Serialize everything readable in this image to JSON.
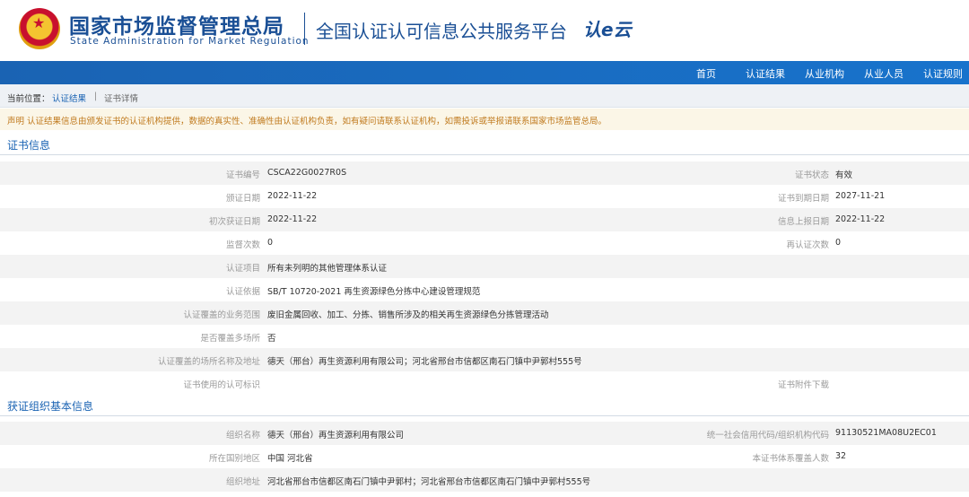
{
  "header": {
    "title_cn": "国家市场监督管理总局",
    "title_en": "State Administration  for  Market Regulation",
    "platform": "全国认证认可信息公共服务平台",
    "logo_mark": "认e云"
  },
  "nav": [
    "首页",
    "认证结果",
    "从业机构",
    "从业人员",
    "认证规则"
  ],
  "breadcrumb": {
    "prefix": "当前位置：",
    "link": "认证结果",
    "sep": "|",
    "current": "证书详情"
  },
  "notice": "声明  认证结果信息由颁发证书的认证机构提供，数据的真实性、准确性由认证机构负责，如有疑问请联系认证机构，如需投诉或举报请联系国家市场监管总局。",
  "cert_section": {
    "title": "证书信息",
    "rows": [
      {
        "l_label": "证书编号",
        "l_value": "CSCA22G0027R0S",
        "r_label": "证书状态",
        "r_value": "有效"
      },
      {
        "l_label": "颁证日期",
        "l_value": "2022-11-22",
        "r_label": "证书到期日期",
        "r_value": "2027-11-21"
      },
      {
        "l_label": "初次获证日期",
        "l_value": "2022-11-22",
        "r_label": "信息上报日期",
        "r_value": "2022-11-22"
      },
      {
        "l_label": "监督次数",
        "l_value": "0",
        "r_label": "再认证次数",
        "r_value": "0"
      },
      {
        "l_label": "认证项目",
        "l_value": "所有未列明的其他管理体系认证",
        "r_label": "",
        "r_value": ""
      },
      {
        "l_label": "认证依据",
        "l_value": "SB/T 10720-2021 再生资源绿色分拣中心建设管理规范",
        "r_label": "",
        "r_value": ""
      },
      {
        "l_label": "认证覆盖的业务范围",
        "l_value": "废旧金属回收、加工、分拣、销售所涉及的相关再生资源绿色分拣管理活动",
        "r_label": "",
        "r_value": ""
      },
      {
        "l_label": "是否覆盖多场所",
        "l_value": "否",
        "r_label": "",
        "r_value": ""
      },
      {
        "l_label": "认证覆盖的场所名称及地址",
        "l_value": "德天（邢台）再生资源利用有限公司；河北省邢台市信都区南石门镇中尹郭村555号",
        "r_label": "",
        "r_value": ""
      },
      {
        "l_label": "证书使用的认可标识",
        "l_value": "",
        "r_label": "证书附件下载",
        "r_value": ""
      }
    ]
  },
  "org_section": {
    "title": "获证组织基本信息",
    "rows": [
      {
        "l_label": "组织名称",
        "l_value": "德天（邢台）再生资源利用有限公司",
        "r_label": "统一社会信用代码/组织机构代码",
        "r_value": "91130521MA08U2EC01"
      },
      {
        "l_label": "所在国别地区",
        "l_value": "中国 河北省",
        "r_label": "本证书体系覆盖人数",
        "r_value": "32"
      },
      {
        "l_label": "组织地址",
        "l_value": "河北省邢台市信都区南石门镇中尹郭村；河北省邢台市信都区南石门镇中尹郭村555号",
        "r_label": "",
        "r_value": ""
      }
    ]
  },
  "colors": {
    "brand_blue": "#1a4f95",
    "nav_blue": "#1a63b3",
    "notice_text": "#c07a1e",
    "notice_bg": "#fbf6e7"
  }
}
